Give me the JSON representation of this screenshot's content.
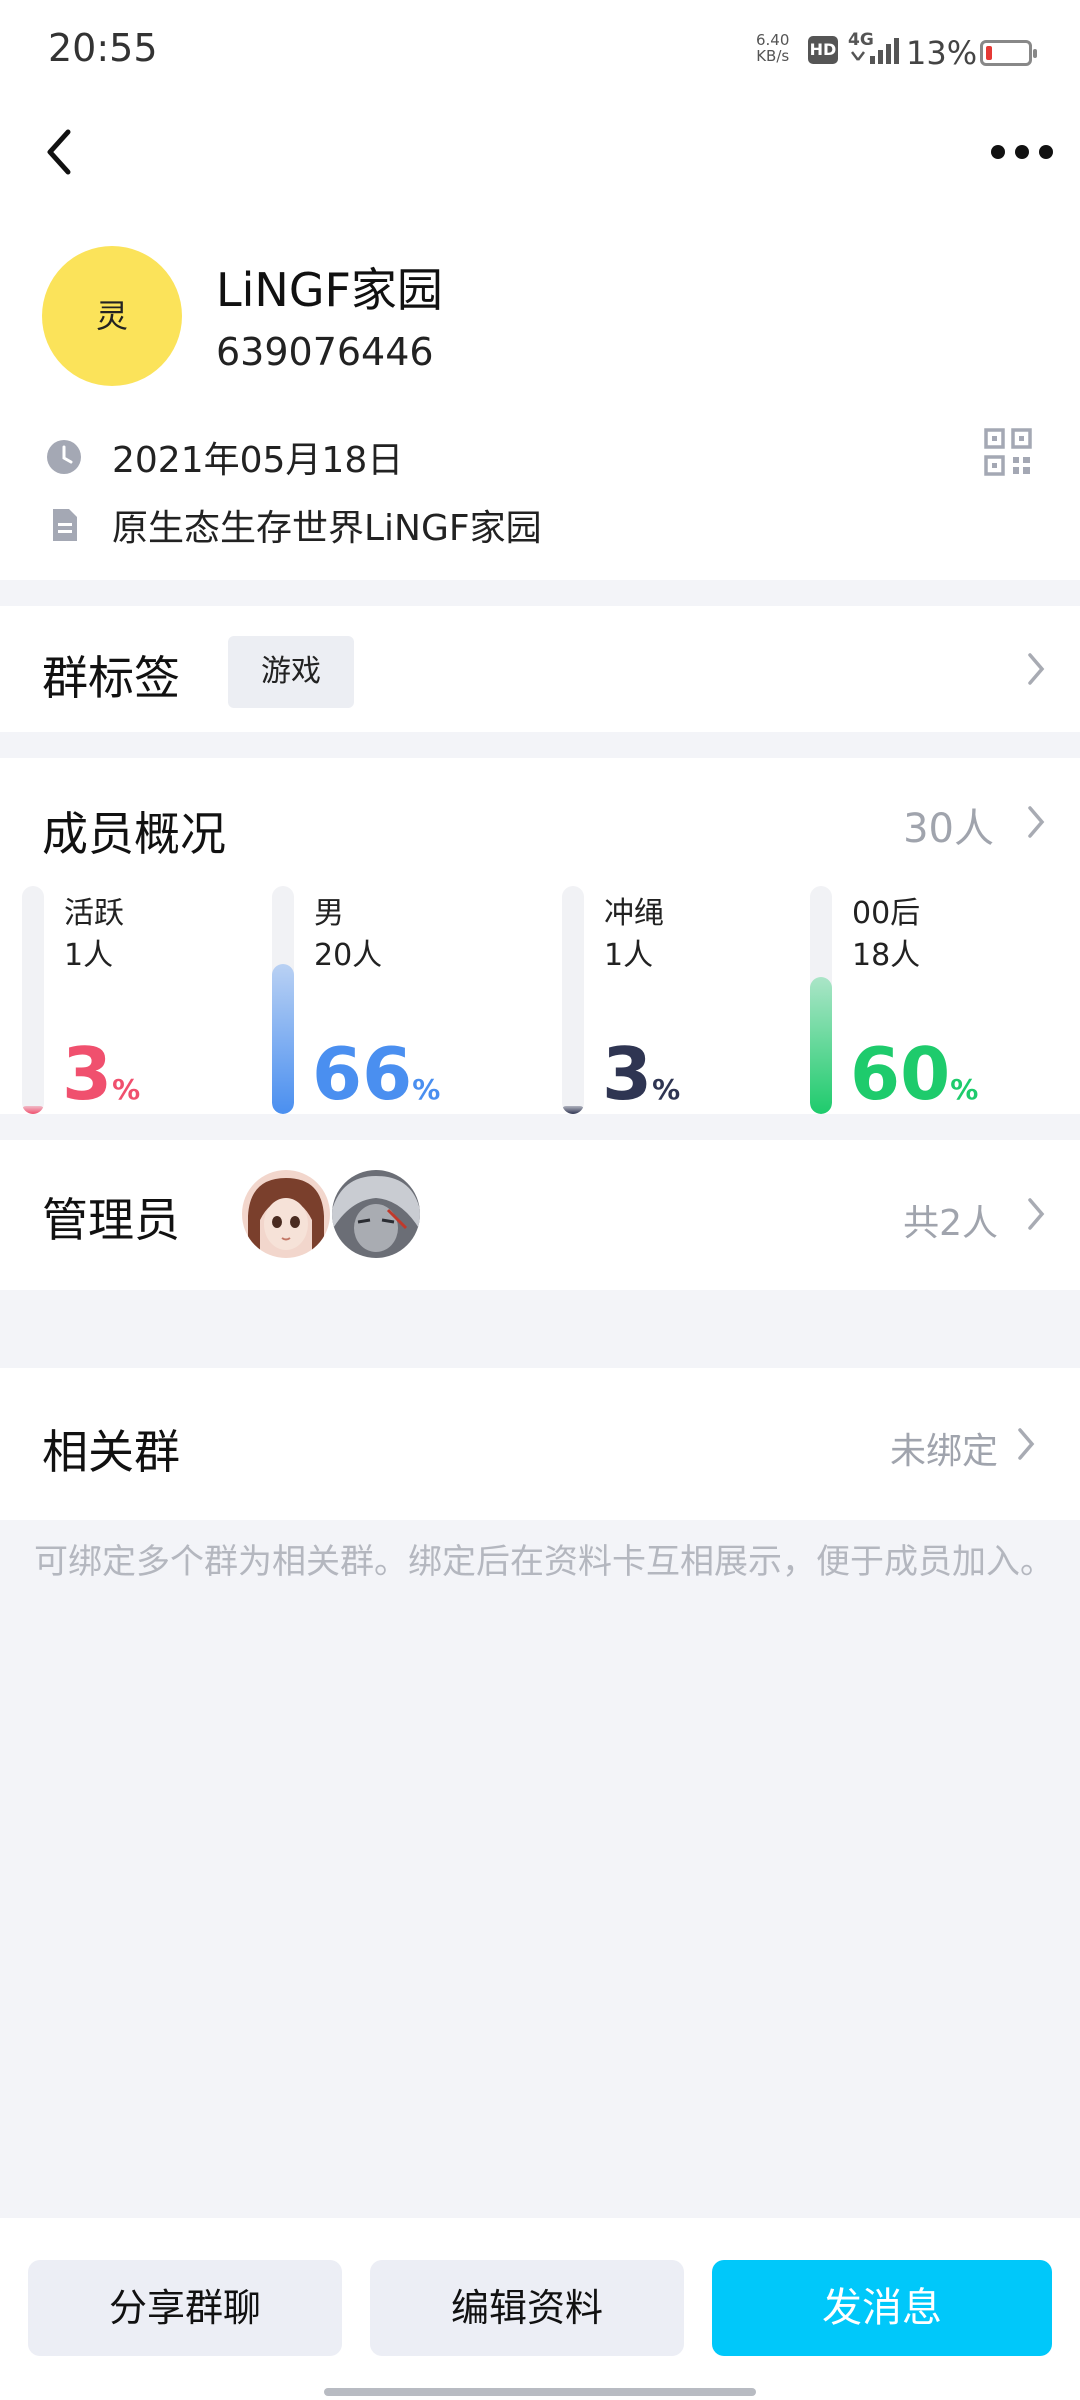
{
  "status_bar": {
    "time": "20:55",
    "net_speed_value": "6.40",
    "net_speed_unit": "KB/s",
    "hd": "HD",
    "network": "4G",
    "battery": "13%"
  },
  "header": {
    "back_icon": "chevron-left-icon",
    "more_icon": "ellipsis-icon",
    "avatar_text": "灵",
    "avatar_color": "#fbe35a",
    "group_name": "LiNGF家园",
    "group_id": "639076446",
    "created_date": "2021年05月18日",
    "description": "原生态生存世界LiNGF家园",
    "qr_icon": "qr-code-icon"
  },
  "tags": {
    "title": "群标签",
    "items": [
      "游戏"
    ]
  },
  "members": {
    "title": "成员概况",
    "total": "30人",
    "stats": [
      {
        "label": "活跃",
        "count": "1人",
        "percent": 3,
        "unit": "%",
        "color": "#f0506e"
      },
      {
        "label": "男",
        "count": "20人",
        "percent": 66,
        "unit": "%",
        "color": "#4a8ff0"
      },
      {
        "label": "冲绳",
        "count": "1人",
        "percent": 3,
        "unit": "%",
        "color": "#2f3552"
      },
      {
        "label": "00后",
        "count": "18人",
        "percent": 60,
        "unit": "%",
        "color": "#1ecb6c"
      }
    ]
  },
  "admins": {
    "title": "管理员",
    "count": "共2人"
  },
  "related": {
    "title": "相关群",
    "value": "未绑定",
    "hint": "可绑定多个群为相关群。绑定后在资料卡互相展示，便于成员加入。"
  },
  "actions": {
    "share": "分享群聊",
    "edit": "编辑资料",
    "message": "发消息",
    "primary_color": "#00c8fa"
  }
}
